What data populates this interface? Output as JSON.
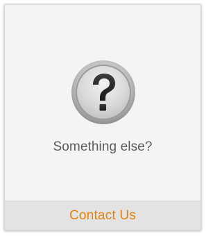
{
  "card": {
    "icon": "question-mark-icon",
    "headline": "Something else?",
    "link_label": "Contact Us"
  },
  "colors": {
    "background": "#f4f4f4",
    "headline": "#5b5b5b",
    "link": "#e3830f",
    "footer": "#e3e3e3"
  }
}
